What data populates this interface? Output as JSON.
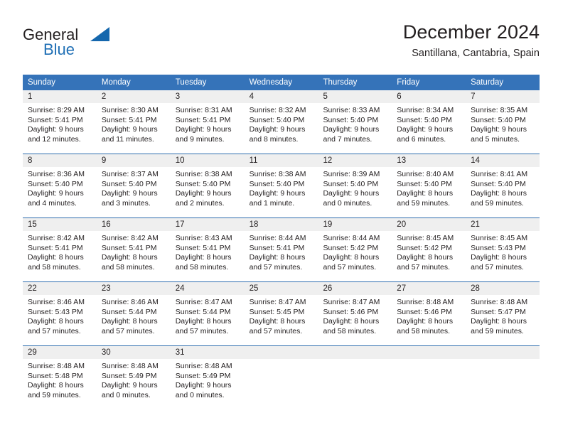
{
  "brand": {
    "name_part1": "General",
    "name_part2": "Blue",
    "triangle_icon": "triangle-icon",
    "accent_color": "#1567ad"
  },
  "header": {
    "title": "December 2024",
    "subtitle": "Santillana, Cantabria, Spain"
  },
  "colors": {
    "header_blue": "#3573b9",
    "row_divider_blue": "#2e6daf",
    "day_band_gray": "#efefef",
    "text": "#231f20"
  },
  "weekdays": [
    "Sunday",
    "Monday",
    "Tuesday",
    "Wednesday",
    "Thursday",
    "Friday",
    "Saturday"
  ],
  "weeks": [
    [
      {
        "day": "1",
        "sunrise": "Sunrise: 8:29 AM",
        "sunset": "Sunset: 5:41 PM",
        "daylight_line1": "Daylight: 9 hours",
        "daylight_line2": "and 12 minutes."
      },
      {
        "day": "2",
        "sunrise": "Sunrise: 8:30 AM",
        "sunset": "Sunset: 5:41 PM",
        "daylight_line1": "Daylight: 9 hours",
        "daylight_line2": "and 11 minutes."
      },
      {
        "day": "3",
        "sunrise": "Sunrise: 8:31 AM",
        "sunset": "Sunset: 5:41 PM",
        "daylight_line1": "Daylight: 9 hours",
        "daylight_line2": "and 9 minutes."
      },
      {
        "day": "4",
        "sunrise": "Sunrise: 8:32 AM",
        "sunset": "Sunset: 5:40 PM",
        "daylight_line1": "Daylight: 9 hours",
        "daylight_line2": "and 8 minutes."
      },
      {
        "day": "5",
        "sunrise": "Sunrise: 8:33 AM",
        "sunset": "Sunset: 5:40 PM",
        "daylight_line1": "Daylight: 9 hours",
        "daylight_line2": "and 7 minutes."
      },
      {
        "day": "6",
        "sunrise": "Sunrise: 8:34 AM",
        "sunset": "Sunset: 5:40 PM",
        "daylight_line1": "Daylight: 9 hours",
        "daylight_line2": "and 6 minutes."
      },
      {
        "day": "7",
        "sunrise": "Sunrise: 8:35 AM",
        "sunset": "Sunset: 5:40 PM",
        "daylight_line1": "Daylight: 9 hours",
        "daylight_line2": "and 5 minutes."
      }
    ],
    [
      {
        "day": "8",
        "sunrise": "Sunrise: 8:36 AM",
        "sunset": "Sunset: 5:40 PM",
        "daylight_line1": "Daylight: 9 hours",
        "daylight_line2": "and 4 minutes."
      },
      {
        "day": "9",
        "sunrise": "Sunrise: 8:37 AM",
        "sunset": "Sunset: 5:40 PM",
        "daylight_line1": "Daylight: 9 hours",
        "daylight_line2": "and 3 minutes."
      },
      {
        "day": "10",
        "sunrise": "Sunrise: 8:38 AM",
        "sunset": "Sunset: 5:40 PM",
        "daylight_line1": "Daylight: 9 hours",
        "daylight_line2": "and 2 minutes."
      },
      {
        "day": "11",
        "sunrise": "Sunrise: 8:38 AM",
        "sunset": "Sunset: 5:40 PM",
        "daylight_line1": "Daylight: 9 hours",
        "daylight_line2": "and 1 minute."
      },
      {
        "day": "12",
        "sunrise": "Sunrise: 8:39 AM",
        "sunset": "Sunset: 5:40 PM",
        "daylight_line1": "Daylight: 9 hours",
        "daylight_line2": "and 0 minutes."
      },
      {
        "day": "13",
        "sunrise": "Sunrise: 8:40 AM",
        "sunset": "Sunset: 5:40 PM",
        "daylight_line1": "Daylight: 8 hours",
        "daylight_line2": "and 59 minutes."
      },
      {
        "day": "14",
        "sunrise": "Sunrise: 8:41 AM",
        "sunset": "Sunset: 5:40 PM",
        "daylight_line1": "Daylight: 8 hours",
        "daylight_line2": "and 59 minutes."
      }
    ],
    [
      {
        "day": "15",
        "sunrise": "Sunrise: 8:42 AM",
        "sunset": "Sunset: 5:41 PM",
        "daylight_line1": "Daylight: 8 hours",
        "daylight_line2": "and 58 minutes."
      },
      {
        "day": "16",
        "sunrise": "Sunrise: 8:42 AM",
        "sunset": "Sunset: 5:41 PM",
        "daylight_line1": "Daylight: 8 hours",
        "daylight_line2": "and 58 minutes."
      },
      {
        "day": "17",
        "sunrise": "Sunrise: 8:43 AM",
        "sunset": "Sunset: 5:41 PM",
        "daylight_line1": "Daylight: 8 hours",
        "daylight_line2": "and 58 minutes."
      },
      {
        "day": "18",
        "sunrise": "Sunrise: 8:44 AM",
        "sunset": "Sunset: 5:41 PM",
        "daylight_line1": "Daylight: 8 hours",
        "daylight_line2": "and 57 minutes."
      },
      {
        "day": "19",
        "sunrise": "Sunrise: 8:44 AM",
        "sunset": "Sunset: 5:42 PM",
        "daylight_line1": "Daylight: 8 hours",
        "daylight_line2": "and 57 minutes."
      },
      {
        "day": "20",
        "sunrise": "Sunrise: 8:45 AM",
        "sunset": "Sunset: 5:42 PM",
        "daylight_line1": "Daylight: 8 hours",
        "daylight_line2": "and 57 minutes."
      },
      {
        "day": "21",
        "sunrise": "Sunrise: 8:45 AM",
        "sunset": "Sunset: 5:43 PM",
        "daylight_line1": "Daylight: 8 hours",
        "daylight_line2": "and 57 minutes."
      }
    ],
    [
      {
        "day": "22",
        "sunrise": "Sunrise: 8:46 AM",
        "sunset": "Sunset: 5:43 PM",
        "daylight_line1": "Daylight: 8 hours",
        "daylight_line2": "and 57 minutes."
      },
      {
        "day": "23",
        "sunrise": "Sunrise: 8:46 AM",
        "sunset": "Sunset: 5:44 PM",
        "daylight_line1": "Daylight: 8 hours",
        "daylight_line2": "and 57 minutes."
      },
      {
        "day": "24",
        "sunrise": "Sunrise: 8:47 AM",
        "sunset": "Sunset: 5:44 PM",
        "daylight_line1": "Daylight: 8 hours",
        "daylight_line2": "and 57 minutes."
      },
      {
        "day": "25",
        "sunrise": "Sunrise: 8:47 AM",
        "sunset": "Sunset: 5:45 PM",
        "daylight_line1": "Daylight: 8 hours",
        "daylight_line2": "and 57 minutes."
      },
      {
        "day": "26",
        "sunrise": "Sunrise: 8:47 AM",
        "sunset": "Sunset: 5:46 PM",
        "daylight_line1": "Daylight: 8 hours",
        "daylight_line2": "and 58 minutes."
      },
      {
        "day": "27",
        "sunrise": "Sunrise: 8:48 AM",
        "sunset": "Sunset: 5:46 PM",
        "daylight_line1": "Daylight: 8 hours",
        "daylight_line2": "and 58 minutes."
      },
      {
        "day": "28",
        "sunrise": "Sunrise: 8:48 AM",
        "sunset": "Sunset: 5:47 PM",
        "daylight_line1": "Daylight: 8 hours",
        "daylight_line2": "and 59 minutes."
      }
    ],
    [
      {
        "day": "29",
        "sunrise": "Sunrise: 8:48 AM",
        "sunset": "Sunset: 5:48 PM",
        "daylight_line1": "Daylight: 8 hours",
        "daylight_line2": "and 59 minutes."
      },
      {
        "day": "30",
        "sunrise": "Sunrise: 8:48 AM",
        "sunset": "Sunset: 5:49 PM",
        "daylight_line1": "Daylight: 9 hours",
        "daylight_line2": "and 0 minutes."
      },
      {
        "day": "31",
        "sunrise": "Sunrise: 8:48 AM",
        "sunset": "Sunset: 5:49 PM",
        "daylight_line1": "Daylight: 9 hours",
        "daylight_line2": "and 0 minutes."
      },
      {
        "day": "",
        "sunrise": "",
        "sunset": "",
        "daylight_line1": "",
        "daylight_line2": ""
      },
      {
        "day": "",
        "sunrise": "",
        "sunset": "",
        "daylight_line1": "",
        "daylight_line2": ""
      },
      {
        "day": "",
        "sunrise": "",
        "sunset": "",
        "daylight_line1": "",
        "daylight_line2": ""
      },
      {
        "day": "",
        "sunrise": "",
        "sunset": "",
        "daylight_line1": "",
        "daylight_line2": ""
      }
    ]
  ]
}
